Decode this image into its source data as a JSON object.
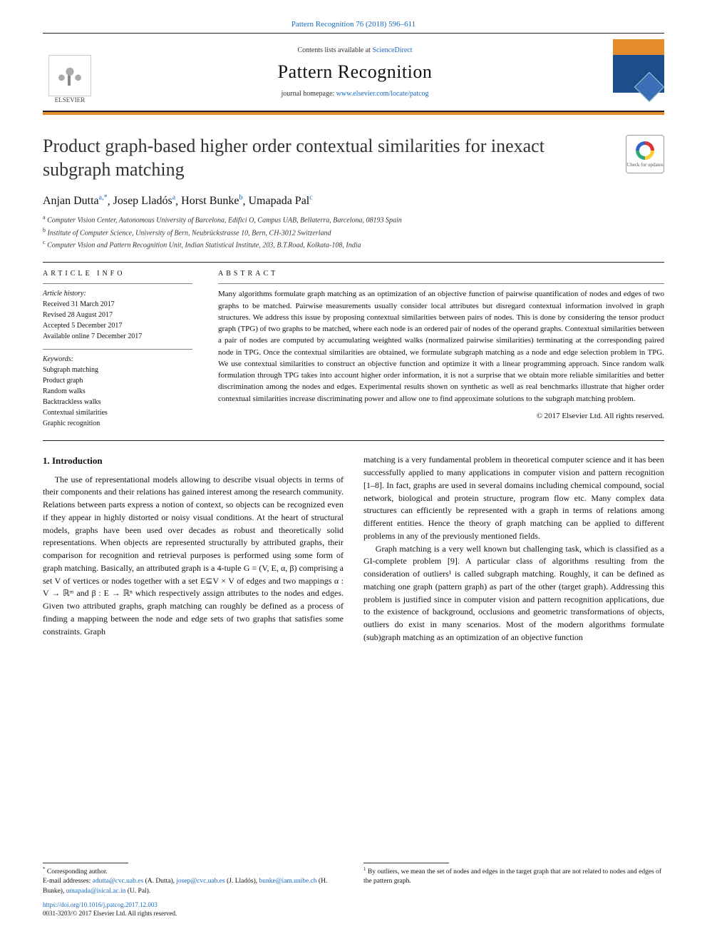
{
  "citation": "Pattern Recognition 76 (2018) 596–611",
  "header": {
    "contents_prefix": "Contents lists available at ",
    "contents_link": "ScienceDirect",
    "journal": "Pattern Recognition",
    "homepage_prefix": "journal homepage: ",
    "homepage_link": "www.elsevier.com/locate/patcog",
    "publisher_label": "ELSEVIER"
  },
  "title": "Product graph-based higher order contextual similarities for inexact subgraph matching",
  "crossmark_label": "Check for updates",
  "authors": [
    {
      "name": "Anjan Dutta",
      "sup": "a,*"
    },
    {
      "name": "Josep Lladós",
      "sup": "a"
    },
    {
      "name": "Horst Bunke",
      "sup": "b"
    },
    {
      "name": "Umapada Pal",
      "sup": "c"
    }
  ],
  "affiliations": [
    {
      "sup": "a",
      "text": "Computer Vision Center, Autonomous University of Barcelona, Edifici O, Campus UAB, Bellaterra, Barcelona, 08193 Spain"
    },
    {
      "sup": "b",
      "text": "Institute of Computer Science, University of Bern, Neubrückstrasse 10, Bern, CH-3012 Switzerland"
    },
    {
      "sup": "c",
      "text": "Computer Vision and Pattern Recognition Unit, Indian Statistical Institute, 203, B.T.Road, Kolkata-108, India"
    }
  ],
  "article_info": {
    "heading": "article info",
    "history_label": "Article history:",
    "history": [
      "Received 31 March 2017",
      "Revised 28 August 2017",
      "Accepted 5 December 2017",
      "Available online 7 December 2017"
    ],
    "keywords_label": "Keywords:",
    "keywords": [
      "Subgraph matching",
      "Product graph",
      "Random walks",
      "Backtrackless walks",
      "Contextual similarities",
      "Graphic recognition"
    ]
  },
  "abstract": {
    "heading": "abstract",
    "text": "Many algorithms formulate graph matching as an optimization of an objective function of pairwise quantification of nodes and edges of two graphs to be matched. Pairwise measurements usually consider local attributes but disregard contextual information involved in graph structures. We address this issue by proposing contextual similarities between pairs of nodes. This is done by considering the tensor product graph (TPG) of two graphs to be matched, where each node is an ordered pair of nodes of the operand graphs. Contextual similarities between a pair of nodes are computed by accumulating weighted walks (normalized pairwise similarities) terminating at the corresponding paired node in TPG. Once the contextual similarities are obtained, we formulate subgraph matching as a node and edge selection problem in TPG. We use contextual similarities to construct an objective function and optimize it with a linear programming approach. Since random walk formulation through TPG takes into account higher order information, it is not a surprise that we obtain more reliable similarities and better discrimination among the nodes and edges. Experimental results shown on synthetic as well as real benchmarks illustrate that higher order contextual similarities increase discriminating power and allow one to find approximate solutions to the subgraph matching problem.",
    "copyright": "© 2017 Elsevier Ltd. All rights reserved."
  },
  "section1": {
    "heading": "1. Introduction",
    "p1": "The use of representational models allowing to describe visual objects in terms of their components and their relations has gained interest among the research community. Relations between parts express a notion of context, so objects can be recognized even if they appear in highly distorted or noisy visual conditions. At the heart of structural models, graphs have been used over decades as robust and theoretically solid representations. When objects are represented structurally by attributed graphs, their comparison for recognition and retrieval purposes is performed using some form of graph matching. Basically, an attributed graph is a 4-tuple G = (V, E, α, β)  comprising a set V of vertices or nodes together with a set E⊆V × V of edges and two mappings  α : V → ℝᵐ  and β : E → ℝⁿ  which respectively assign attributes to the nodes and edges. Given two attributed graphs, graph matching can roughly be defined as a process of finding a mapping between the node and edge sets of two graphs that satisfies some constraints. Graph",
    "p2": "matching is a very fundamental problem in theoretical computer science and it has been successfully applied to many applications in computer vision and pattern recognition [1–8]. In fact, graphs are used in several domains including chemical compound, social network, biological and protein structure, program flow etc. Many complex data structures can efficiently be represented with a graph in terms of relations among different entities. Hence the theory of graph matching can be applied to different problems in any of the previously mentioned fields.",
    "p3": "Graph matching is a very well known but challenging task, which is classified as a GI-complete problem [9]. A particular class of algorithms resulting from the consideration of outliers¹ is called subgraph matching. Roughly, it can be defined as matching one graph (pattern graph) as part of the other (target graph). Addressing this problem is justified since in computer vision and pattern recognition applications, due to the existence of background, occlusions and geometric transformations of objects, outliers do exist in many scenarios. Most of the modern algorithms formulate (sub)graph matching as an optimization of an objective function"
  },
  "footnotes": {
    "left": {
      "corr": "Corresponding author.",
      "emails_label": "E-mail addresses: ",
      "emails": [
        {
          "addr": "adutta@cvc.uab.es",
          "who": "(A. Dutta)"
        },
        {
          "addr": "josep@cvc.uab.es",
          "who": "(J. Lladós)"
        },
        {
          "addr": "bunke@iam.unibe.ch",
          "who": "(H. Bunke)"
        },
        {
          "addr": "umapada@isical.ac.in",
          "who": "(U. Pal)."
        }
      ],
      "doi": "https://doi.org/10.1016/j.patcog.2017.12.003",
      "issn": "0031-3203/© 2017 Elsevier Ltd. All rights reserved."
    },
    "right": {
      "note": "By outliers, we mean the set of nodes and edges in the target graph that are not related to nodes and edges of the pattern graph."
    }
  }
}
